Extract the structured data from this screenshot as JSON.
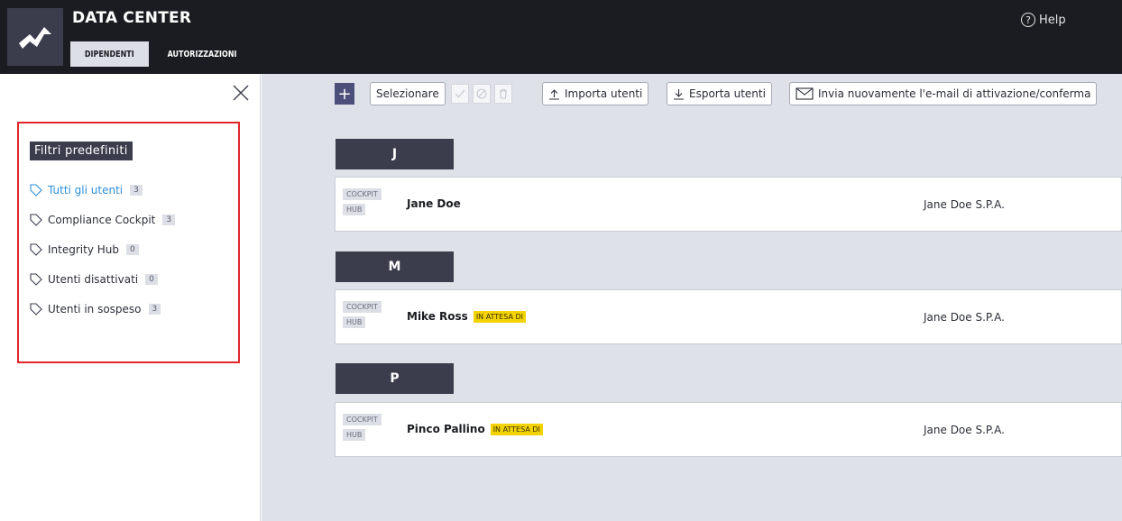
{
  "header": {
    "app_title": "DATA CENTER",
    "tabs": [
      {
        "label": "DIPENDENTI",
        "active": true
      },
      {
        "label": "AUTORIZZAZIONI",
        "active": false
      }
    ],
    "help_label": "Help",
    "help_glyph": "?"
  },
  "sidebar": {
    "close_icon": "close-icon",
    "filters_title": "Filtri predefiniti",
    "filters": [
      {
        "label": "Tutti gli utenti",
        "count": "3",
        "active": true
      },
      {
        "label": "Compliance Cockpit",
        "count": "3",
        "active": false
      },
      {
        "label": "Integrity Hub",
        "count": "0",
        "active": false
      },
      {
        "label": "Utenti disattivati",
        "count": "0",
        "active": false
      },
      {
        "label": "Utenti in sospeso",
        "count": "3",
        "active": false
      }
    ]
  },
  "toolbar": {
    "add_label": "+",
    "select_label": "Selezionare",
    "import_label": "Importa utenti",
    "export_label": "Esporta utenti",
    "resend_label": "Invia nuovamente l'e-mail di attivazione/conferma"
  },
  "groups": [
    {
      "letter": "J",
      "users": [
        {
          "tags": [
            "COCKPIT",
            "HUB"
          ],
          "name": "Jane Doe",
          "pending": "",
          "company": "Jane Doe S.P.A."
        }
      ]
    },
    {
      "letter": "M",
      "users": [
        {
          "tags": [
            "COCKPIT",
            "HUB"
          ],
          "name": "Mike Ross",
          "pending": "IN ATTESA DI",
          "company": "Jane Doe S.P.A."
        }
      ]
    },
    {
      "letter": "P",
      "users": [
        {
          "tags": [
            "COCKPIT",
            "HUB"
          ],
          "name": "Pinco Pallino",
          "pending": "IN ATTESA DI",
          "company": "Jane Doe S.P.A."
        }
      ]
    }
  ],
  "colors": {
    "header_bg": "#1b1c21",
    "accent_dark": "#3b3d4d",
    "active_filter": "#2e8fd8",
    "pending_badge": "#f2d300",
    "highlight_border": "#e0262a"
  }
}
